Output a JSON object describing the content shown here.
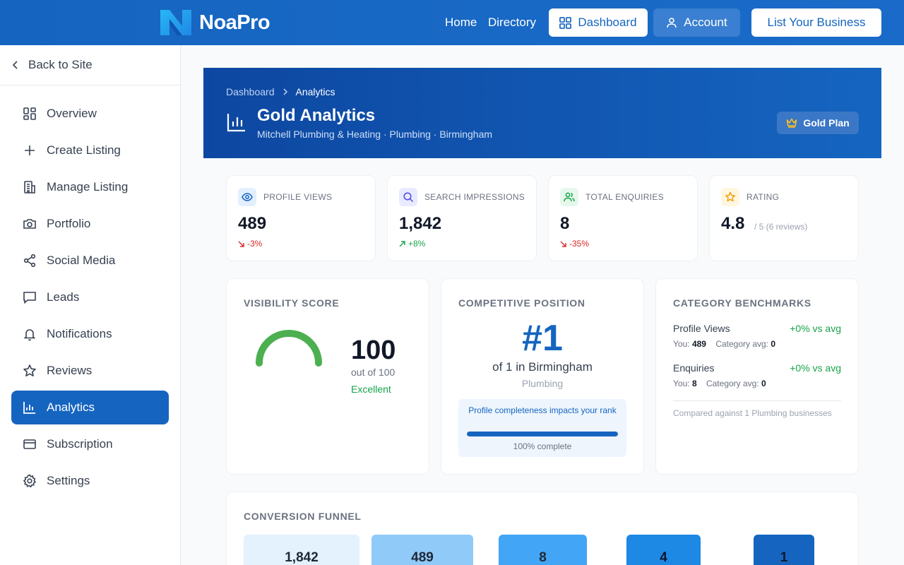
{
  "brand": {
    "name": "NoaPro"
  },
  "nav": {
    "home": "Home",
    "directory": "Directory",
    "dashboard": "Dashboard",
    "account": "Account",
    "list_business": "List Your Business"
  },
  "sidebar": {
    "back": "Back to Site",
    "items": [
      {
        "label": "Overview",
        "icon": "grid-icon"
      },
      {
        "label": "Create Listing",
        "icon": "plus-icon"
      },
      {
        "label": "Manage Listing",
        "icon": "building-icon"
      },
      {
        "label": "Portfolio",
        "icon": "camera-icon"
      },
      {
        "label": "Social Media",
        "icon": "share-icon"
      },
      {
        "label": "Leads",
        "icon": "message-icon"
      },
      {
        "label": "Notifications",
        "icon": "bell-icon"
      },
      {
        "label": "Reviews",
        "icon": "star-icon"
      },
      {
        "label": "Analytics",
        "icon": "bar-chart-icon",
        "active": true
      },
      {
        "label": "Subscription",
        "icon": "credit-card-icon"
      },
      {
        "label": "Settings",
        "icon": "gear-icon"
      }
    ]
  },
  "hero": {
    "breadcrumb": [
      "Dashboard",
      "Analytics"
    ],
    "title": "Gold Analytics",
    "subtitle": "Mitchell Plumbing & Heating · Plumbing · Birmingham",
    "badge": "Gold Plan"
  },
  "stats": [
    {
      "label": "PROFILE VIEWS",
      "value": "489",
      "delta": "-3%",
      "trend": "down",
      "icon": "eye-icon"
    },
    {
      "label": "SEARCH IMPRESSIONS",
      "value": "1,842",
      "delta": "+8%",
      "trend": "up",
      "icon": "search-icon"
    },
    {
      "label": "TOTAL ENQUIRIES",
      "value": "8",
      "delta": "-35%",
      "trend": "down",
      "icon": "users-icon"
    },
    {
      "label": "RATING",
      "value": "4.8",
      "suffix": "/ 5 (6 reviews)",
      "icon": "star-icon"
    }
  ],
  "visibility": {
    "title": "VISIBILITY SCORE",
    "score": "100",
    "score_fraction": 1.0,
    "out_of": "out of 100",
    "grade": "Excellent"
  },
  "competitive": {
    "title": "COMPETITIVE POSITION",
    "rank": "#1",
    "of_text": "of 1 in Birmingham",
    "category": "Plumbing",
    "completeness_msg": "Profile completeness impacts your rank",
    "completeness_fraction": 1.0,
    "completeness_text": "100% complete"
  },
  "benchmarks": {
    "title": "CATEGORY BENCHMARKS",
    "rows": [
      {
        "name": "Profile Views",
        "delta": "+0% vs avg",
        "you_label": "You:",
        "you": "489",
        "avg_label": "Category avg:",
        "avg": "0"
      },
      {
        "name": "Enquiries",
        "delta": "+0% vs avg",
        "you_label": "You:",
        "you": "8",
        "avg_label": "Category avg:",
        "avg": "0"
      }
    ],
    "note": "Compared against 1 Plumbing businesses"
  },
  "funnel": {
    "title": "CONVERSION FUNNEL",
    "steps": [
      {
        "value": "1,842",
        "color": "#e3f2fd"
      },
      {
        "value": "489",
        "color": "#90caf9"
      },
      {
        "value": "8",
        "color": "#42a5f5"
      },
      {
        "value": "4",
        "color": "#1e88e5"
      },
      {
        "value": "1",
        "color": "#1565c0"
      }
    ]
  },
  "colors": {
    "primary": "#1565c0",
    "positive": "#16a34a",
    "negative": "#dc2626",
    "gauge": "#4caf50"
  }
}
